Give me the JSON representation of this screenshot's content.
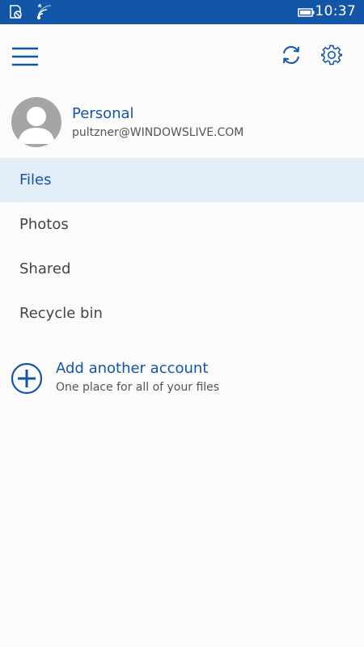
{
  "status_bar": {
    "time": "10:37",
    "icons": [
      "notification-icon",
      "wifi-icon",
      "battery-icon"
    ]
  },
  "toolbar": {
    "menu_icon": "hamburger-icon",
    "sync_icon": "sync-icon",
    "settings_icon": "gear-icon"
  },
  "account": {
    "name": "Personal",
    "email": "pultzner@WINDOWSLIVE.COM"
  },
  "nav": {
    "items": [
      {
        "label": "Files",
        "active": true
      },
      {
        "label": "Photos",
        "active": false
      },
      {
        "label": "Shared",
        "active": false
      },
      {
        "label": "Recycle bin",
        "active": false
      }
    ]
  },
  "add_account": {
    "title": "Add another account",
    "subtitle": "One place for all of your files"
  },
  "colors": {
    "accent": "#1356a8",
    "active_bg": "#e3eef8",
    "background": "#fbfbfb"
  }
}
